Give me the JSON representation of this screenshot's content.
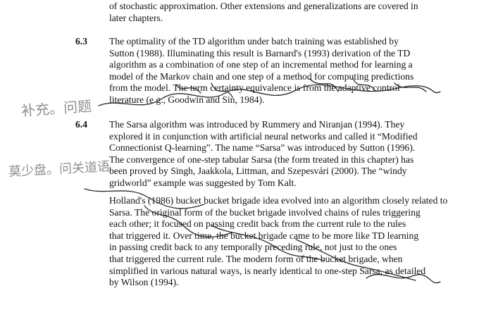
{
  "document": {
    "intro_lines": [
      "of stochastic approximation. Other extensions and generalizations are covered in",
      "later chapters."
    ],
    "sections": [
      {
        "number": "6.3",
        "lines": [
          "The optimality of the TD algorithm under batch training was established by",
          "Sutton (1988). Illuminating this result is Barnard's (1993) derivation of the TD",
          "algorithm as a combination of one step of an incremental method for learning a",
          "model of the Markov chain and one step of a method for computing predictions",
          "from the model. The term certainty equivalence is from the adaptive control",
          "literature (e.g., Goodwin and Sin, 1984)."
        ]
      },
      {
        "number": "6.4",
        "lines": [
          "The Sarsa algorithm was introduced by Rummery and Niranjan (1994). They",
          "explored it in conjunction with artificial neural networks and called it “Modified",
          "Connectionist Q-learning”. The name “Sarsa” was introduced by Sutton (1996).",
          "The convergence of one-step tabular Sarsa (the form treated in this chapter) has",
          "been proved by Singh, Jaakkola, Littman, and Szepesvári (2000). The “windy",
          "gridworld” example was suggested by Tom Kalt."
        ]
      }
    ],
    "final_paragraph_lines": [
      "Holland's (1986) bucket bucket brigade idea evolved into an algorithm closely related to",
      "Sarsa. The original form of the bucket brigade involved chains of rules triggering",
      "each other; it focused on passing credit back from the current rule to the rules",
      "that triggered it. Over time, the bucket brigade came to be more like TD learning",
      "in passing credit back to any temporally preceding rule, not just to the ones",
      "that triggered the current rule. The modern form of the bucket brigade, when",
      "simplified in various natural ways, is nearly identical to one-step Sarsa, as detailed",
      "by Wilson (1994)."
    ]
  },
  "handwriting": {
    "note_left_upper": "补充。问题",
    "note_left_lower": "莫少盘。问关道语"
  }
}
